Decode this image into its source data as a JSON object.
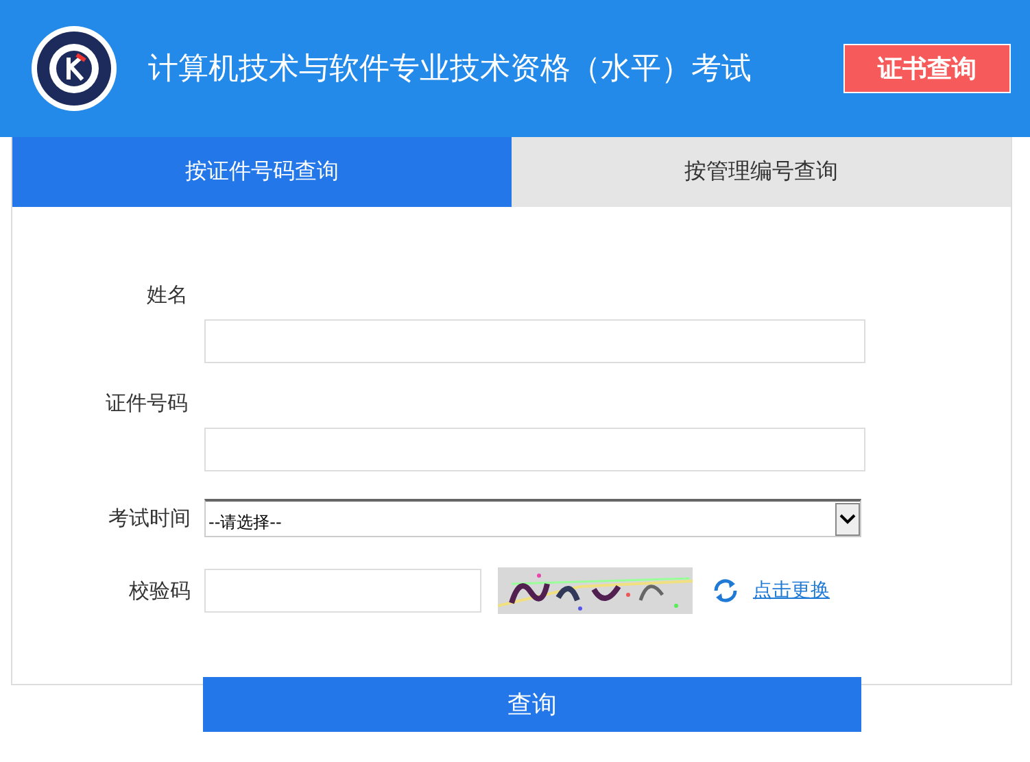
{
  "header": {
    "title": "计算机技术与软件专业技术资格（水平）考试",
    "button": "证书查询"
  },
  "tabs": [
    {
      "label": "按证件号码查询",
      "selected": true
    },
    {
      "label": "按管理编号查询",
      "selected": false
    }
  ],
  "form": {
    "fields": [
      {
        "kind": "text",
        "label": "姓名"
      },
      {
        "kind": "text",
        "label": "证件号码"
      },
      {
        "kind": "select",
        "label": "考试时间",
        "value": "--请选择--"
      },
      {
        "kind": "captcha",
        "label": "校验码",
        "link": "点击更换"
      }
    ]
  },
  "submit": "查询"
}
